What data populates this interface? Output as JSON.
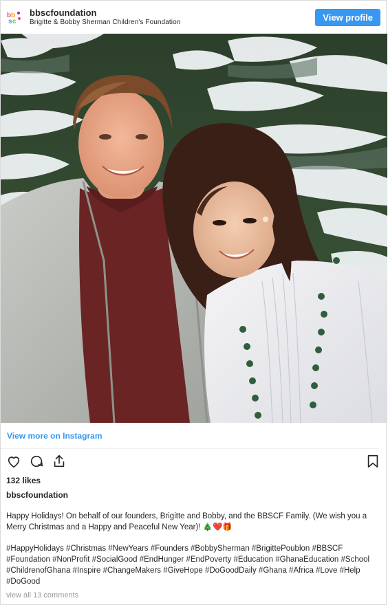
{
  "header": {
    "username": "bbscfoundation",
    "full_name": "Brigitte & Bobby Sherman Children's Foundation",
    "view_profile_label": "View profile",
    "avatar_icon": "bbscf-logo-icon"
  },
  "photo": {
    "alt": "Bobby Sherman and Brigitte Poublon in front of snowy evergreen trees"
  },
  "view_more_label": "View more on Instagram",
  "actions": {
    "like_icon": "heart-icon",
    "comment_icon": "comment-icon",
    "share_icon": "share-icon",
    "save_icon": "bookmark-icon"
  },
  "likes_label": "132 likes",
  "author": "bbscfoundation",
  "caption": {
    "text": "Happy Holidays! On behalf of our founders, Brigitte and Bobby, and the BBSCF Family. (We wish you a Merry Christmas and a Happy and Peaceful New Year)! 🎄❤️🎁",
    "hashtags": "#HappyHolidays #Christmas #NewYears #Founders #BobbySherman #BrigittePoublon #BBSCF #Foundation #NonProfit #SocialGood #EndHunger #EndPoverty #Education #GhanaEducation #School #ChildrenofGhana #Inspire #ChangeMakers #GiveHope #DoGoodDaily #Ghana #Africa #Love #Help #DoGood"
  },
  "view_comments_label": "view all 13 comments",
  "colors": {
    "accent": "#3897f0",
    "text": "#262626",
    "muted": "#999999"
  }
}
